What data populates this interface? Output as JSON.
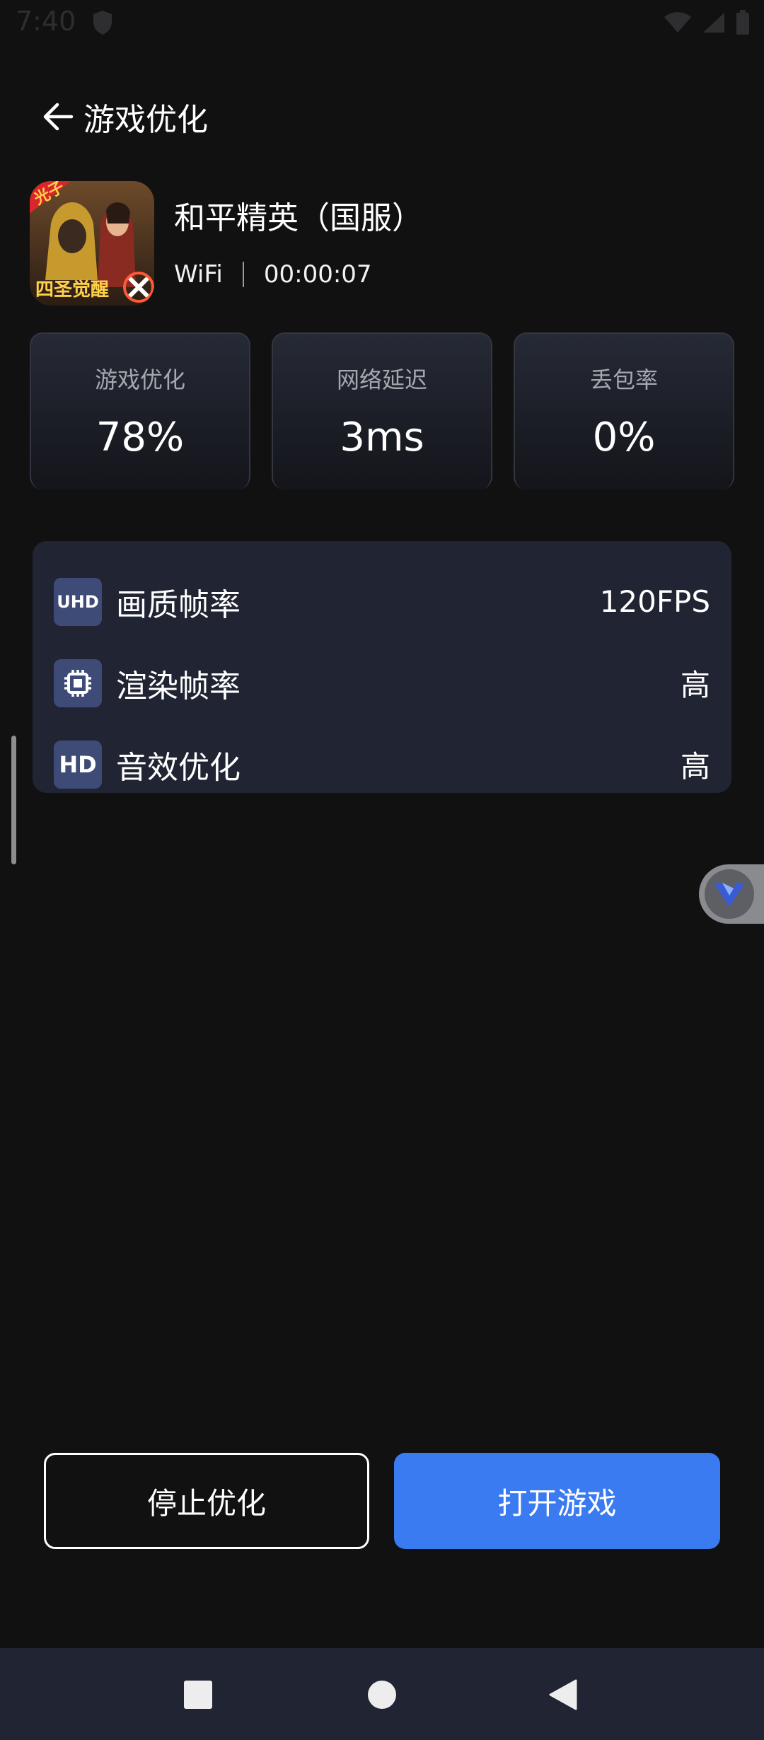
{
  "status_bar": {
    "time": "7:40",
    "icons": [
      "shield-icon",
      "wifi-icon",
      "signal-icon",
      "battery-icon"
    ]
  },
  "header": {
    "back_icon": "arrow-left-icon",
    "title": "游戏优化"
  },
  "game": {
    "name": "和平精英（国服）",
    "network": "WiFi",
    "duration": "00:00:07",
    "icon_text_top": "光子",
    "icon_text_bottom": "四圣觉醒"
  },
  "stats": [
    {
      "label": "游戏优化",
      "value": "78%"
    },
    {
      "label": "网络延迟",
      "value": "3ms"
    },
    {
      "label": "丢包率",
      "value": "0%"
    }
  ],
  "features": [
    {
      "badge": "UHD",
      "label": "画质帧率",
      "value": "120FPS"
    },
    {
      "badge": "chip-icon",
      "label": "渲染帧率",
      "value": "高"
    },
    {
      "badge": "HD",
      "label": "音效优化",
      "value": "高"
    }
  ],
  "buttons": {
    "stop": "停止优化",
    "open": "打开游戏"
  },
  "nav": [
    "recents-square-icon",
    "home-circle-icon",
    "back-triangle-icon"
  ],
  "colors": {
    "background": "#111112",
    "panel": "#212533",
    "badge": "#3e4b76",
    "accent": "#3b7bf2",
    "nav_bar": "#202433"
  }
}
